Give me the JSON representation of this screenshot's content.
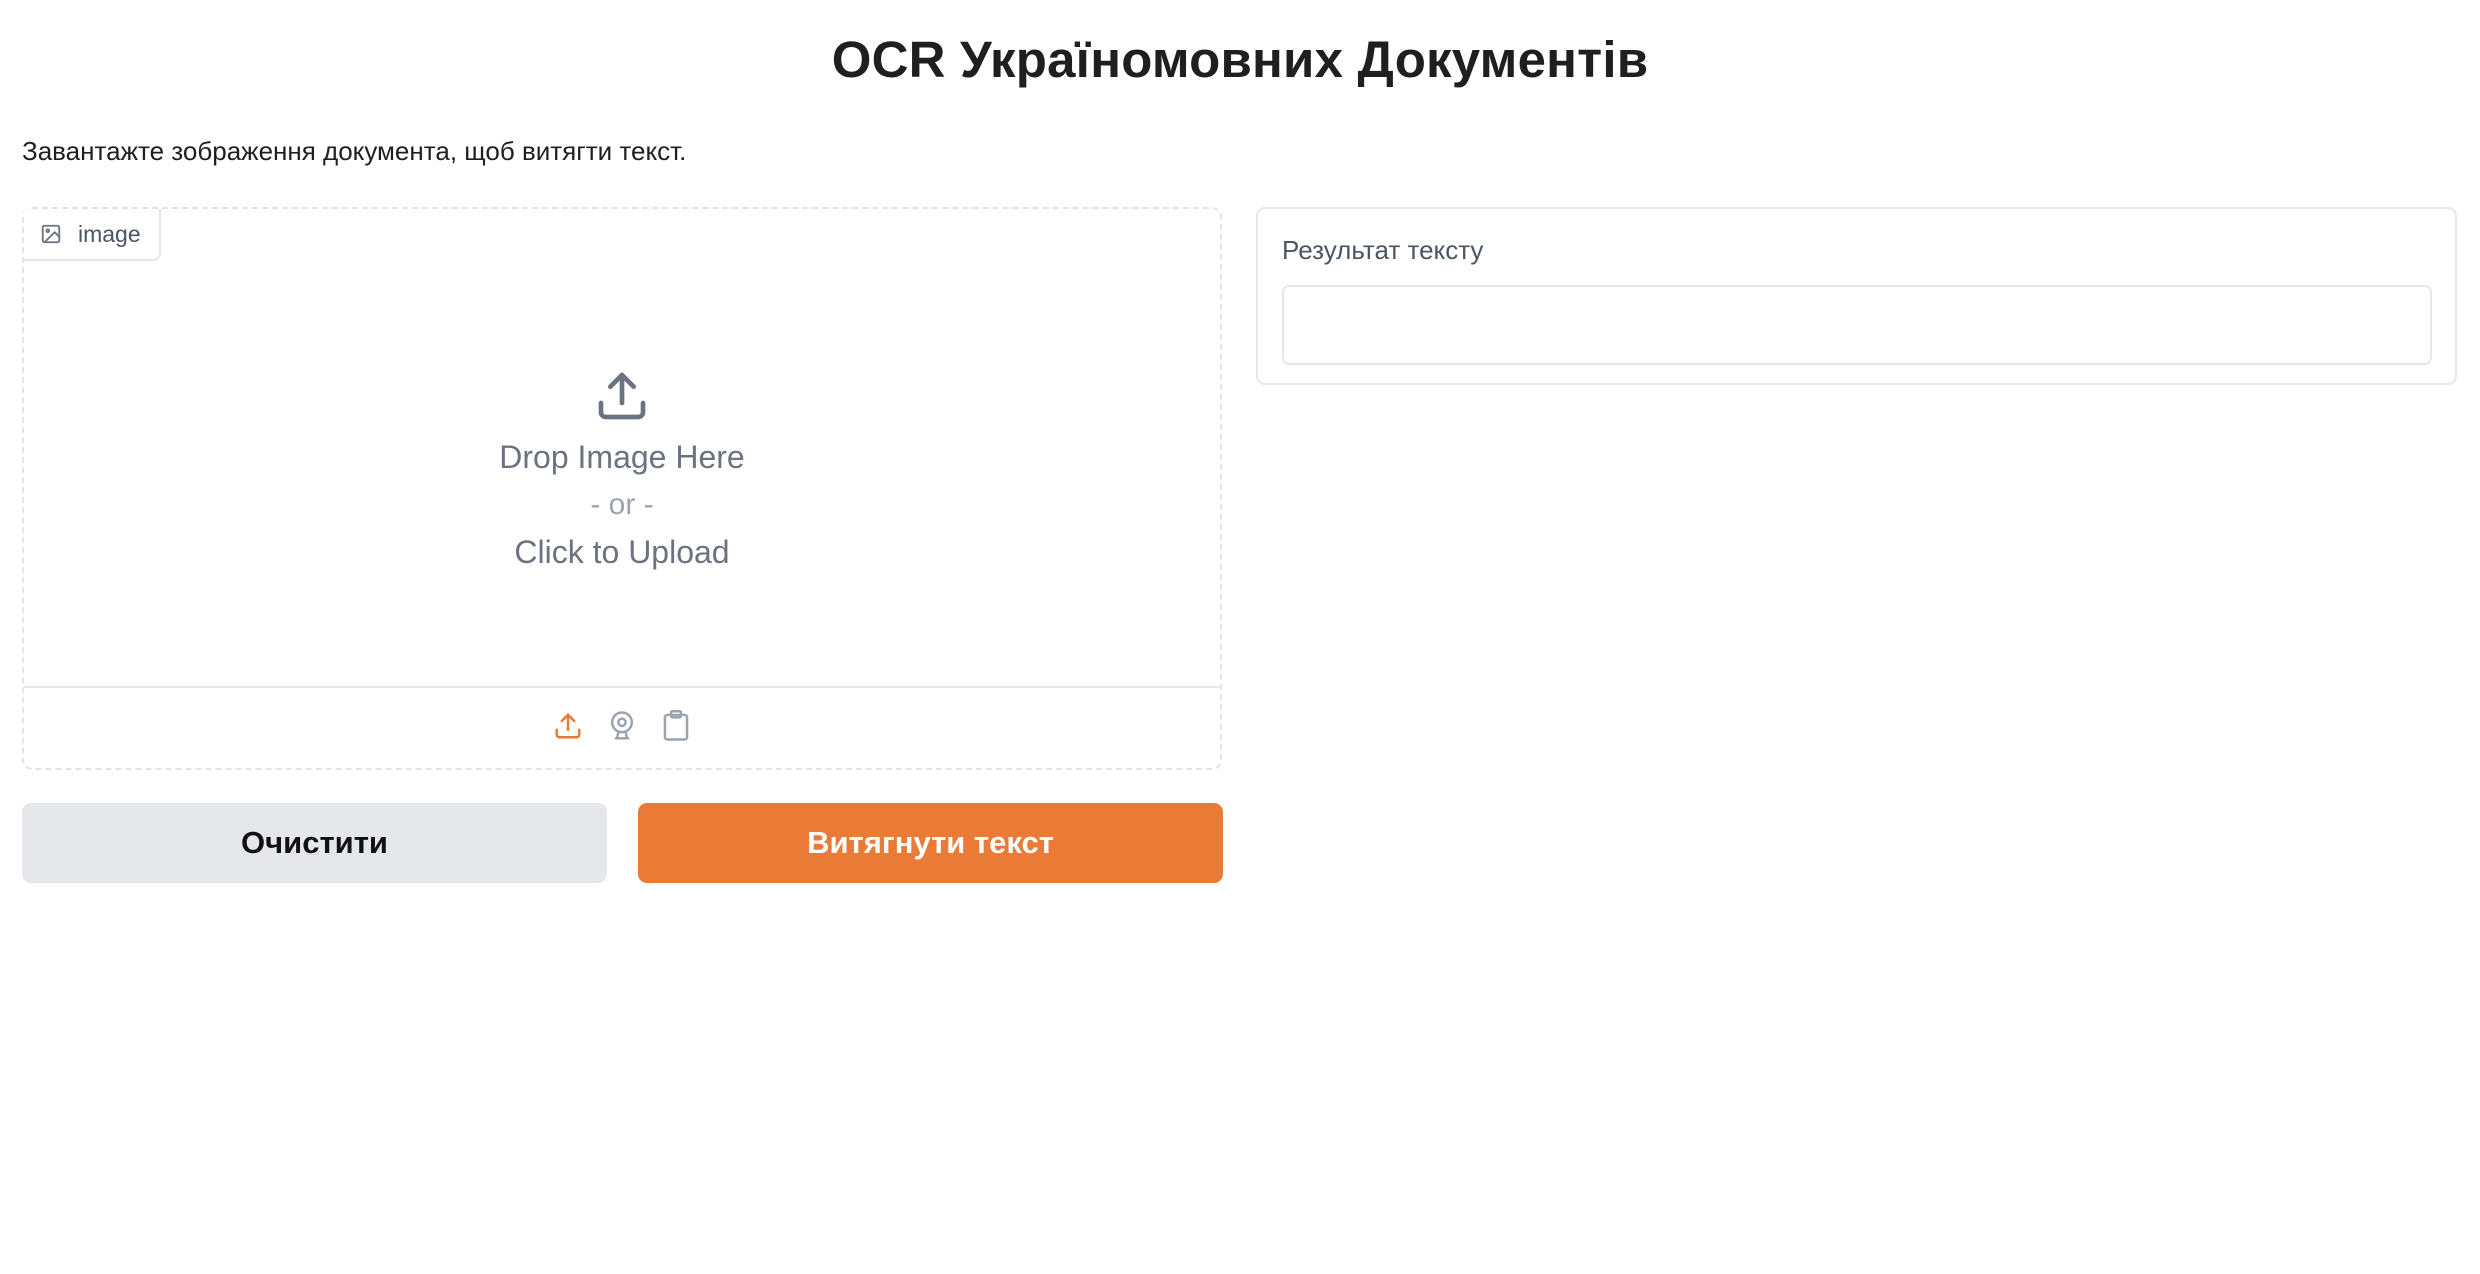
{
  "header": {
    "title": "OCR Україномовних Документів",
    "subtitle": "Завантажте зображення документа, щоб витягти текст."
  },
  "image_input": {
    "label": "image",
    "label_icon": "image-icon",
    "drop_text": "Drop Image Here",
    "or_text": "- or -",
    "click_text": "Click to Upload",
    "sources": [
      "upload-icon",
      "webcam-icon",
      "clipboard-icon"
    ],
    "active_source_color": "#e97b36",
    "inactive_source_color": "#9ca3af"
  },
  "buttons": {
    "clear_label": "Очистити",
    "extract_label": "Витягнути текст",
    "extract_color": "#e97b36",
    "clear_color": "#e5e7eb"
  },
  "result": {
    "label": "Результат тексту",
    "value": ""
  }
}
